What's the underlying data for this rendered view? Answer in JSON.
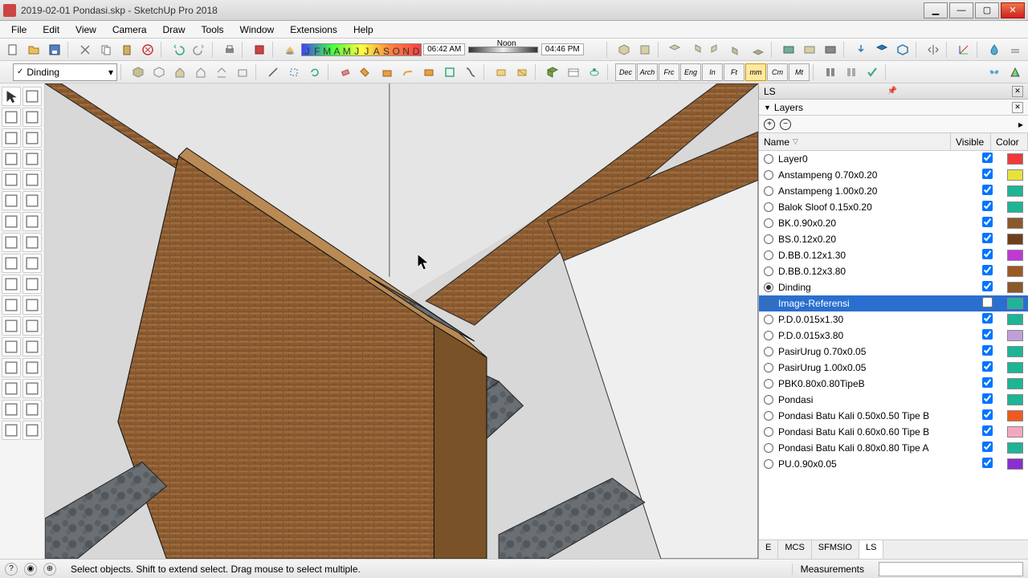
{
  "title": "2019-02-01 Pondasi.skp - SketchUp Pro 2018",
  "menu": [
    "File",
    "Edit",
    "View",
    "Camera",
    "Draw",
    "Tools",
    "Window",
    "Extensions",
    "Help"
  ],
  "months": [
    "J",
    "F",
    "M",
    "A",
    "M",
    "J",
    "J",
    "A",
    "S",
    "O",
    "N",
    "D"
  ],
  "time": {
    "start": "06:42 AM",
    "mid": "Noon",
    "end": "04:46 PM"
  },
  "layer_combo": "Dinding",
  "units": [
    "Dec",
    "Arch",
    "Frc",
    "Eng",
    "In",
    "Ft",
    "mm",
    "Cm",
    "Mt"
  ],
  "unit_active": "mm",
  "panel": {
    "tray": "LS",
    "title": "Layers",
    "cols": {
      "name": "Name",
      "visible": "Visible",
      "color": "Color"
    },
    "tabs": [
      "E",
      "MCS",
      "SFMSIO",
      "LS"
    ],
    "tab_active": "LS"
  },
  "layers": [
    {
      "name": "Layer0",
      "active": false,
      "visible": true,
      "color": "#ef3a3a"
    },
    {
      "name": "Anstampeng 0.70x0.20",
      "active": false,
      "visible": true,
      "color": "#e7e23a"
    },
    {
      "name": "Anstampeng 1.00x0.20",
      "active": false,
      "visible": true,
      "color": "#1db596"
    },
    {
      "name": "Balok Sloof 0.15x0.20",
      "active": false,
      "visible": true,
      "color": "#1db596"
    },
    {
      "name": "BK.0.90x0.20",
      "active": false,
      "visible": true,
      "color": "#8a5a2b"
    },
    {
      "name": "BS.0.12x0.20",
      "active": false,
      "visible": true,
      "color": "#6e3f1a"
    },
    {
      "name": "D.BB.0.12x1.30",
      "active": false,
      "visible": true,
      "color": "#c038d6"
    },
    {
      "name": "D.BB.0.12x3.80",
      "active": false,
      "visible": true,
      "color": "#9c5a23"
    },
    {
      "name": "Dinding",
      "active": true,
      "visible": true,
      "color": "#8a5a2b"
    },
    {
      "name": "Image-Referensi",
      "active": false,
      "visible": false,
      "color": "#1db596",
      "selected": true
    },
    {
      "name": "P.D.0.015x1.30",
      "active": false,
      "visible": true,
      "color": "#1db596"
    },
    {
      "name": "P.D.0.015x3.80",
      "active": false,
      "visible": true,
      "color": "#bda0d8"
    },
    {
      "name": "PasirUrug 0.70x0.05",
      "active": false,
      "visible": true,
      "color": "#1db596"
    },
    {
      "name": "PasirUrug 1.00x0.05",
      "active": false,
      "visible": true,
      "color": "#1db596"
    },
    {
      "name": "PBK0.80x0.80TipeB",
      "active": false,
      "visible": true,
      "color": "#1db596"
    },
    {
      "name": "Pondasi",
      "active": false,
      "visible": true,
      "color": "#1db596"
    },
    {
      "name": "Pondasi Batu Kali 0.50x0.50 Tipe B",
      "active": false,
      "visible": true,
      "color": "#ef5b1f"
    },
    {
      "name": "Pondasi Batu Kali 0.60x0.60 Tipe B",
      "active": false,
      "visible": true,
      "color": "#f4a8bf"
    },
    {
      "name": "Pondasi Batu Kali 0.80x0.80 Tipe A",
      "active": false,
      "visible": true,
      "color": "#1db596"
    },
    {
      "name": "PU.0.90x0.05",
      "active": false,
      "visible": true,
      "color": "#8b2fd0"
    }
  ],
  "status": {
    "hint": "Select objects. Shift to extend select. Drag mouse to select multiple.",
    "meas_label": "Measurements"
  }
}
